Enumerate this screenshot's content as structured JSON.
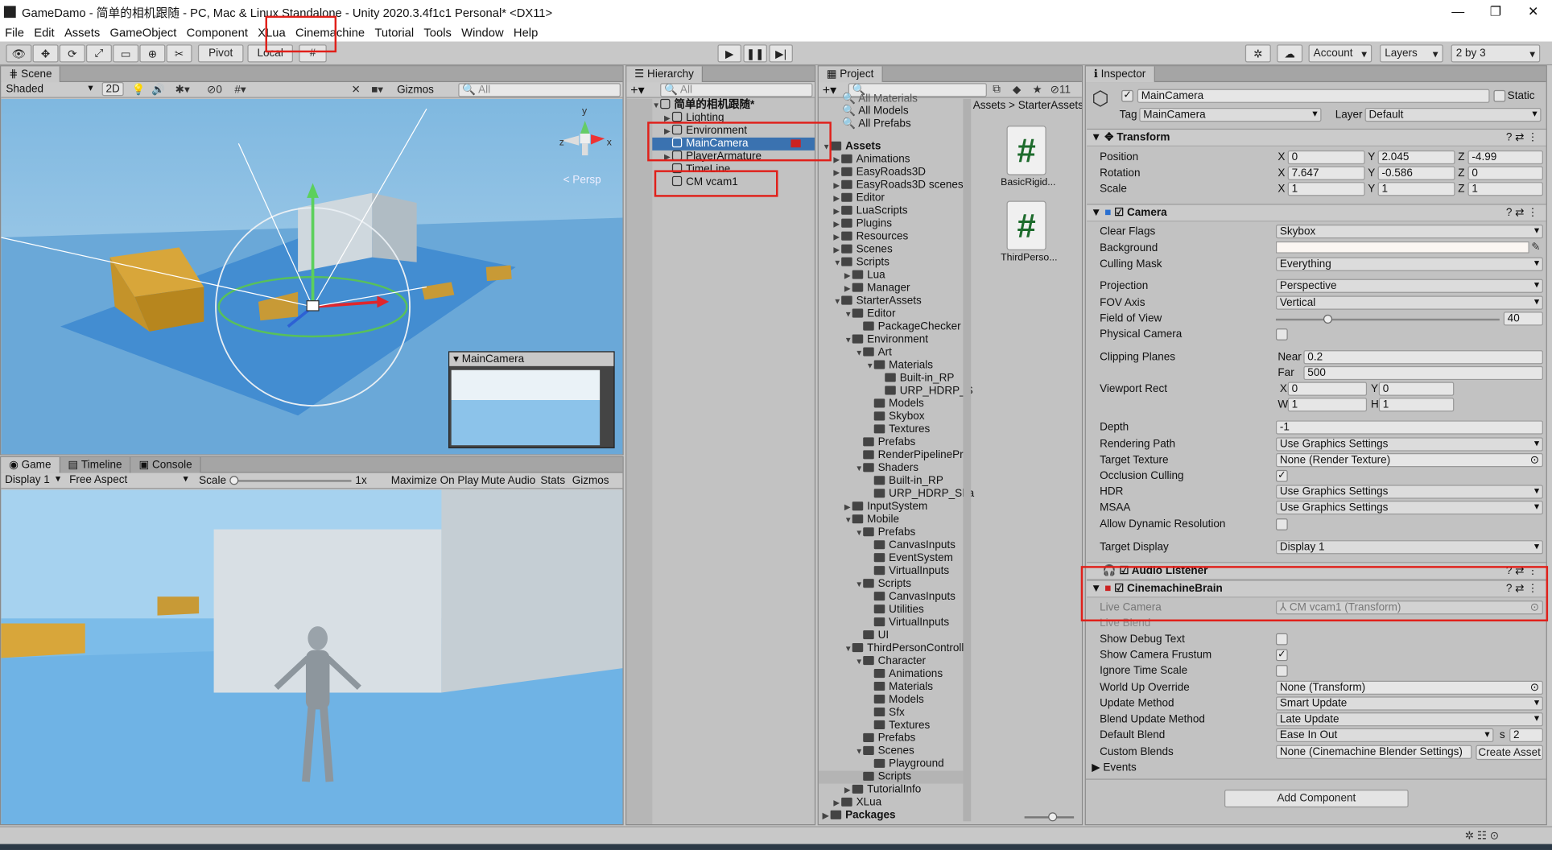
{
  "window": {
    "title": "GameDamo - 简单的相机跟随 - PC, Mac & Linux Standalone - Unity 2020.3.4f1c1 Personal* <DX11>",
    "minimize": "—",
    "maximize": "❐",
    "close": "✕"
  },
  "menu": [
    "File",
    "Edit",
    "Assets",
    "GameObject",
    "Component",
    "XLua",
    "Cinemachine",
    "Tutorial",
    "Tools",
    "Window",
    "Help"
  ],
  "toolbar": {
    "pivot": "Pivot",
    "local": "Local",
    "account": "Account",
    "layers": "Layers",
    "layout": "2 by 3"
  },
  "scene": {
    "tab": "Scene",
    "shading": "Shaded",
    "mode2d": "2D",
    "gizmos": "Gizmos",
    "search_placeholder": "All",
    "hidden_count": "0",
    "persp_label": "< Persp",
    "preview_title": "MainCamera",
    "axis_y": "y",
    "axis_x": "x",
    "axis_z": "z"
  },
  "game": {
    "tab": "Game",
    "tab2": "Timeline",
    "tab3": "Console",
    "display": "Display 1",
    "aspect": "Free Aspect",
    "scale_label": "Scale",
    "scale_value": "1x",
    "maximize": "Maximize On Play",
    "mute": "Mute Audio",
    "stats": "Stats",
    "gizmos": "Gizmos"
  },
  "hierarchy": {
    "tab": "Hierarchy",
    "search_placeholder": "All",
    "scene_name": "简单的相机跟随*",
    "items": [
      "Lighting",
      "Environment",
      "MainCamera",
      "PlayerArmature",
      "TimeLine",
      "CM vcam1"
    ]
  },
  "project": {
    "tab": "Project",
    "badge": "11",
    "favorites": [
      "All Materials",
      "All Models",
      "All Prefabs"
    ],
    "breadcrumb": [
      "Assets",
      "StarterAssets"
    ],
    "tree": [
      {
        "label": "Assets",
        "depth": 0,
        "bold": true
      },
      {
        "label": "Animations",
        "depth": 1
      },
      {
        "label": "EasyRoads3D",
        "depth": 1
      },
      {
        "label": "EasyRoads3D scenes",
        "depth": 1
      },
      {
        "label": "Editor",
        "depth": 1
      },
      {
        "label": "LuaScripts",
        "depth": 1
      },
      {
        "label": "Plugins",
        "depth": 1
      },
      {
        "label": "Resources",
        "depth": 1
      },
      {
        "label": "Scenes",
        "depth": 1
      },
      {
        "label": "Scripts",
        "depth": 1
      },
      {
        "label": "Lua",
        "depth": 2
      },
      {
        "label": "Manager",
        "depth": 2
      },
      {
        "label": "StarterAssets",
        "depth": 1
      },
      {
        "label": "Editor",
        "depth": 2
      },
      {
        "label": "PackageChecker",
        "depth": 3
      },
      {
        "label": "Environment",
        "depth": 2
      },
      {
        "label": "Art",
        "depth": 3
      },
      {
        "label": "Materials",
        "depth": 4
      },
      {
        "label": "Built-in_RP",
        "depth": 5
      },
      {
        "label": "URP_HDRP_S",
        "depth": 5
      },
      {
        "label": "Models",
        "depth": 4
      },
      {
        "label": "Skybox",
        "depth": 4
      },
      {
        "label": "Textures",
        "depth": 4
      },
      {
        "label": "Prefabs",
        "depth": 3
      },
      {
        "label": "RenderPipelinePro",
        "depth": 3
      },
      {
        "label": "Shaders",
        "depth": 3
      },
      {
        "label": "Built-in_RP",
        "depth": 4
      },
      {
        "label": "URP_HDRP_Sha",
        "depth": 4
      },
      {
        "label": "InputSystem",
        "depth": 2
      },
      {
        "label": "Mobile",
        "depth": 2
      },
      {
        "label": "Prefabs",
        "depth": 3
      },
      {
        "label": "CanvasInputs",
        "depth": 4
      },
      {
        "label": "EventSystem",
        "depth": 4
      },
      {
        "label": "VirtualInputs",
        "depth": 4
      },
      {
        "label": "Scripts",
        "depth": 3
      },
      {
        "label": "CanvasInputs",
        "depth": 4
      },
      {
        "label": "Utilities",
        "depth": 4
      },
      {
        "label": "VirtualInputs",
        "depth": 4
      },
      {
        "label": "UI",
        "depth": 3
      },
      {
        "label": "ThirdPersonControlle",
        "depth": 2
      },
      {
        "label": "Character",
        "depth": 3
      },
      {
        "label": "Animations",
        "depth": 4
      },
      {
        "label": "Materials",
        "depth": 4
      },
      {
        "label": "Models",
        "depth": 4
      },
      {
        "label": "Sfx",
        "depth": 4
      },
      {
        "label": "Textures",
        "depth": 4
      },
      {
        "label": "Prefabs",
        "depth": 3
      },
      {
        "label": "Scenes",
        "depth": 3
      },
      {
        "label": "Playground",
        "depth": 4
      },
      {
        "label": "Scripts",
        "depth": 3
      },
      {
        "label": "TutorialInfo",
        "depth": 2
      },
      {
        "label": "XLua",
        "depth": 1
      },
      {
        "label": "Packages",
        "depth": 0,
        "bold": true
      }
    ],
    "assets": [
      "BasicRigid...",
      "ThirdPerso..."
    ]
  },
  "inspector": {
    "tab": "Inspector",
    "object_name": "MainCamera",
    "static_label": "Static",
    "tag_label": "Tag",
    "tag_value": "MainCamera",
    "layer_label": "Layer",
    "layer_value": "Default",
    "transform": {
      "title": "Transform",
      "position_label": "Position",
      "position": {
        "x": "0",
        "y": "2.045",
        "z": "-4.99"
      },
      "rotation_label": "Rotation",
      "rotation": {
        "x": "7.647",
        "y": "-0.586",
        "z": "0"
      },
      "scale_label": "Scale",
      "scale": {
        "x": "1",
        "y": "1",
        "z": "1"
      }
    },
    "camera": {
      "title": "Camera",
      "clear_flags_label": "Clear Flags",
      "clear_flags": "Skybox",
      "background_label": "Background",
      "culling_mask_label": "Culling Mask",
      "culling_mask": "Everything",
      "projection_label": "Projection",
      "projection": "Perspective",
      "fov_axis_label": "FOV Axis",
      "fov_axis": "Vertical",
      "fov_label": "Field of View",
      "fov": "40",
      "physical_label": "Physical Camera",
      "clipping_label": "Clipping Planes",
      "near_label": "Near",
      "near": "0.2",
      "far_label": "Far",
      "far": "500",
      "viewport_label": "Viewport Rect",
      "vx": "0",
      "vy": "0",
      "vw": "1",
      "vh": "1",
      "depth_label": "Depth",
      "depth": "-1",
      "rendering_path_label": "Rendering Path",
      "rendering_path": "Use Graphics Settings",
      "target_texture_label": "Target Texture",
      "target_texture": "None (Render Texture)",
      "occlusion_label": "Occlusion Culling",
      "hdr_label": "HDR",
      "hdr": "Use Graphics Settings",
      "msaa_label": "MSAA",
      "msaa": "Use Graphics Settings",
      "dynres_label": "Allow Dynamic Resolution",
      "target_display_label": "Target Display",
      "target_display": "Display 1"
    },
    "audio_listener": {
      "title": "Audio Listener"
    },
    "brain": {
      "title": "CinemachineBrain",
      "live_camera_label": "Live Camera",
      "live_camera": "CM vcam1 (Transform)",
      "live_blend_label": "Live Blend",
      "debug_label": "Show Debug Text",
      "frustum_label": "Show Camera Frustum",
      "ignore_time_label": "Ignore Time Scale",
      "world_up_label": "World Up Override",
      "world_up": "None (Transform)",
      "update_method_label": "Update Method",
      "update_method": "Smart Update",
      "blend_update_label": "Blend Update Method",
      "blend_update": "Late Update",
      "default_blend_label": "Default Blend",
      "default_blend": "Ease In Out",
      "blend_s": "s",
      "blend_time": "2",
      "custom_blends_label": "Custom Blends",
      "custom_blends": "None (Cinemachine Blender Settings)",
      "create_asset": "Create Asset",
      "events_label": "Events"
    },
    "add_component": "Add Component"
  },
  "colors": {
    "highlight_red": "#e0201a",
    "selection_blue": "#3a72b0",
    "sky": "#8ec5e8",
    "ground": "#5ba3d6"
  }
}
